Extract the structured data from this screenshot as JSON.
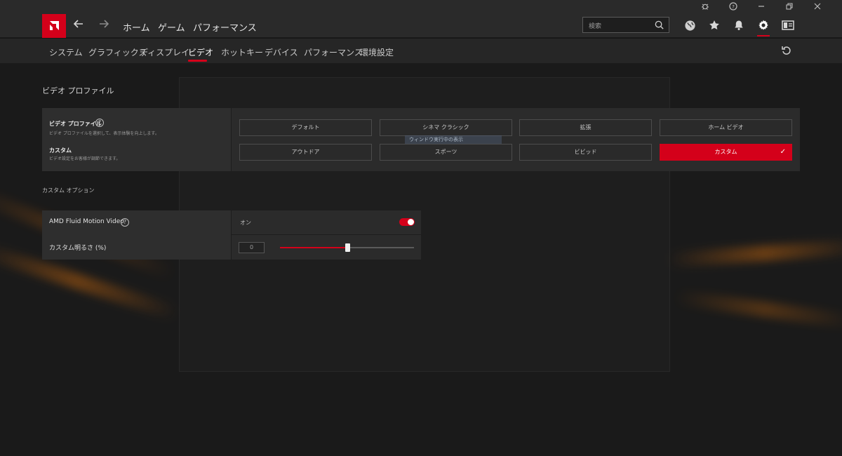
{
  "nav": {
    "home": "ホーム",
    "game": "ゲーム",
    "performance": "パフォーマンス",
    "search_placeholder": "検索"
  },
  "subnav": {
    "tabs": [
      "システム",
      "グラフィックス",
      "ディスプレイ",
      "ビデオ",
      "ホットキー",
      "デバイス",
      "パフォーマンス",
      "環境設定"
    ],
    "active_index": 3
  },
  "video_profile": {
    "section_title": "ビデオ プロファイル",
    "label": "ビデオ プロファイル",
    "desc": "ビデオ プロファイルを選択して、表示体験を向上します。",
    "custom_label": "カスタム",
    "custom_desc": "ビデオ設定をお客様が調節できます。",
    "options": [
      "デフォルト",
      "シネマ クラシック",
      "拡張",
      "ホーム ビデオ",
      "アウトドア",
      "スポーツ",
      "ビビッド",
      "カスタム"
    ],
    "selected": "カスタム"
  },
  "ghost_tooltip": "ウィンドウ実行中の表示",
  "custom_options": {
    "section_title": "カスタム オプション",
    "fluid_motion_label": "AMD Fluid Motion Video",
    "fluid_motion_value": "オン",
    "fluid_motion_on": true,
    "brightness_label": "カスタム明るさ (%)",
    "brightness_value": "0",
    "brightness_slider_fraction": 0.5
  },
  "colors": {
    "accent": "#d4001a"
  }
}
